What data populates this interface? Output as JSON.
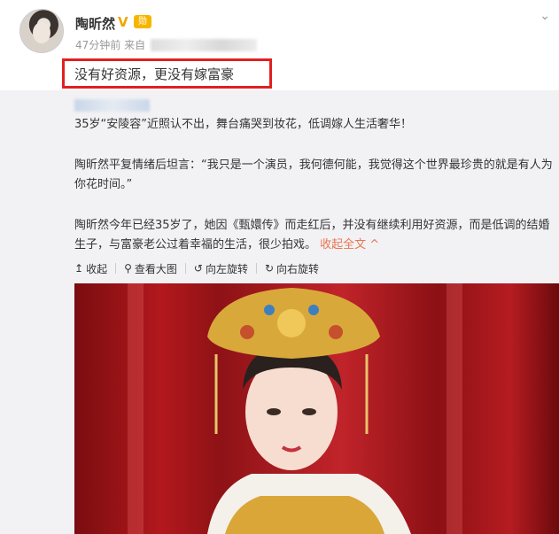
{
  "post": {
    "username": "陶昕然",
    "time": "47分钟前",
    "source_prefix": "来自",
    "text": "没有好资源，更没有嫁富豪"
  },
  "repost": {
    "paragraphs": [
      "35岁“安陵容”近照认不出，舞台痛哭到妆花，低调嫁人生活奢华！",
      "陶昕然平复情绪后坦言：“我只是一个演员，我何德何能，我觉得这个世界最珍贵的就是有人为你花时间。”",
      "陶昕然今年已经35岁了，她因《甄嬛传》而走红后，并没有继续利用好资源，而是低调的结婚生子，与富豪老公过着幸福的生活，很少拍戏。"
    ],
    "collapse_label": "收起全文 ^",
    "toolbar": {
      "collapse": "收起",
      "view_large": "查看大图",
      "rotate_left": "向左旋转",
      "rotate_right": "向右旋转"
    }
  },
  "colors": {
    "highlight_border": "#e02020",
    "link_orange": "#eb7350",
    "vip_gold": "#f0a500"
  },
  "icons": [
    "chevron-down-icon",
    "verified-v-icon",
    "medal-icon",
    "collapse-arrow-icon",
    "magnifier-icon",
    "rotate-left-icon",
    "rotate-right-icon"
  ]
}
